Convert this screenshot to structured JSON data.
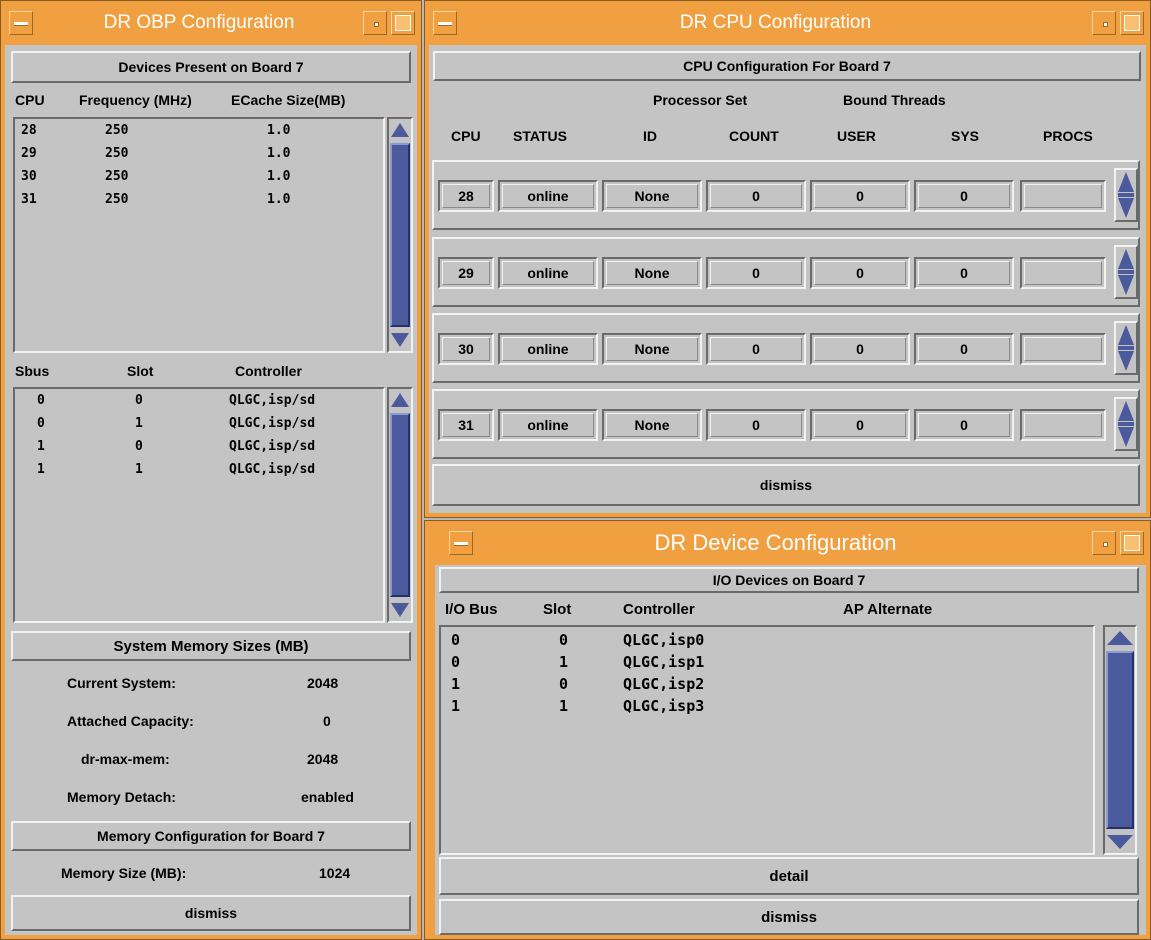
{
  "obp": {
    "title": "DR OBP Configuration",
    "devices_header": "Devices Present on Board 7",
    "cpu_cols": [
      "CPU",
      "Frequency (MHz)",
      "ECache Size(MB)"
    ],
    "cpus": [
      {
        "cpu": "28",
        "freq": "250",
        "ecache": "1.0"
      },
      {
        "cpu": "29",
        "freq": "250",
        "ecache": "1.0"
      },
      {
        "cpu": "30",
        "freq": "250",
        "ecache": "1.0"
      },
      {
        "cpu": "31",
        "freq": "250",
        "ecache": "1.0"
      }
    ],
    "sbus_cols": [
      "Sbus",
      "Slot",
      "Controller"
    ],
    "sbus": [
      {
        "sbus": "0",
        "slot": "0",
        "controller": "QLGC,isp/sd"
      },
      {
        "sbus": "0",
        "slot": "1",
        "controller": "QLGC,isp/sd"
      },
      {
        "sbus": "1",
        "slot": "0",
        "controller": "QLGC,isp/sd"
      },
      {
        "sbus": "1",
        "slot": "1",
        "controller": "QLGC,isp/sd"
      }
    ],
    "mem_header": "System Memory Sizes (MB)",
    "mem": [
      {
        "label": "Current System:",
        "value": "2048"
      },
      {
        "label": "Attached Capacity:",
        "value": "0"
      },
      {
        "label": "dr-max-mem:",
        "value": "2048"
      },
      {
        "label": "Memory Detach:",
        "value": "enabled"
      }
    ],
    "board_mem_header": "Memory Configuration for Board 7",
    "board_mem_label": "Memory Size (MB):",
    "board_mem_value": "1024",
    "dismiss": "dismiss"
  },
  "cpu": {
    "title": "DR CPU Configuration",
    "header": "CPU Configuration For Board 7",
    "group_processor_set": "Processor Set",
    "group_bound_threads": "Bound Threads",
    "cols": [
      "CPU",
      "STATUS",
      "ID",
      "COUNT",
      "USER",
      "SYS",
      "PROCS"
    ],
    "rows": [
      {
        "cpu": "28",
        "status": "online",
        "id": "None",
        "count": "0",
        "user": "0",
        "sys": "0",
        "procs": ""
      },
      {
        "cpu": "29",
        "status": "online",
        "id": "None",
        "count": "0",
        "user": "0",
        "sys": "0",
        "procs": ""
      },
      {
        "cpu": "30",
        "status": "online",
        "id": "None",
        "count": "0",
        "user": "0",
        "sys": "0",
        "procs": ""
      },
      {
        "cpu": "31",
        "status": "online",
        "id": "None",
        "count": "0",
        "user": "0",
        "sys": "0",
        "procs": ""
      }
    ],
    "dismiss": "dismiss"
  },
  "device": {
    "title": "DR Device Configuration",
    "header": "I/O Devices on Board 7",
    "cols": [
      "I/O Bus",
      "Slot",
      "Controller",
      "AP Alternate"
    ],
    "rows": [
      {
        "bus": "0",
        "slot": "0",
        "controller": "QLGC,isp0",
        "ap": ""
      },
      {
        "bus": "0",
        "slot": "1",
        "controller": "QLGC,isp1",
        "ap": ""
      },
      {
        "bus": "1",
        "slot": "0",
        "controller": "QLGC,isp2",
        "ap": ""
      },
      {
        "bus": "1",
        "slot": "1",
        "controller": "QLGC,isp3",
        "ap": ""
      }
    ],
    "detail": "detail",
    "dismiss": "dismiss"
  },
  "colors": {
    "titlebar": "#f0a040",
    "panel": "#c4c4c4",
    "scroll_thumb": "#4a5a9c"
  }
}
